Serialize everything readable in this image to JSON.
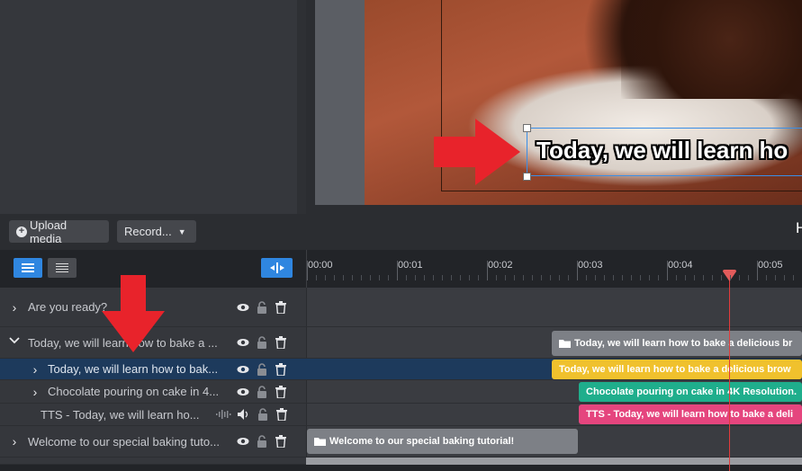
{
  "media": {
    "upload_label": "Upload media",
    "record_label": "Record...",
    "plus_icon": "plus-circle-icon",
    "caret_icon": "caret-down-icon"
  },
  "preview": {
    "caption": "Today, we will learn ho",
    "side_letter": "H"
  },
  "timeline": {
    "ticks": [
      "00:00",
      "00:01",
      "00:02",
      "00:03",
      "00:04",
      "00:05"
    ],
    "playhead_time_seconds": 4.7,
    "playhead_color": "#e23b3b"
  },
  "layers": [
    {
      "label": "Are you ready?",
      "chevron": "›",
      "expanded": false
    },
    {
      "label": "Today, we will learn how to bake a ...",
      "chevron": "⌄",
      "expanded": true
    },
    {
      "label": "Today, we will learn how to bak...",
      "chevron": "›",
      "selected": true
    },
    {
      "label": "Chocolate pouring on cake in 4...",
      "chevron": "›"
    },
    {
      "label": "TTS - Today, we will learn ho...",
      "chevron": ""
    },
    {
      "label": "Welcome to our special baking tuto...",
      "chevron": "›"
    }
  ],
  "clips": {
    "group": {
      "label": "Today, we will learn how to bake a delicious br",
      "color": "#7d8086"
    },
    "caption": {
      "label": "Today, we will learn how to bake a delicious brow",
      "color": "#f0c12d"
    },
    "video": {
      "label": "Chocolate pouring on cake in 4K Resolution.",
      "color": "#1fae8c"
    },
    "tts": {
      "label": "TTS - Today, we will learn how to bake a deli",
      "color": "#e5457e"
    },
    "welcome": {
      "label": "Welcome to our special baking tutorial!",
      "color": "#7d8086"
    }
  },
  "colors": {
    "accent": "#2f86e0",
    "annotation_arrow": "#e8232b"
  }
}
